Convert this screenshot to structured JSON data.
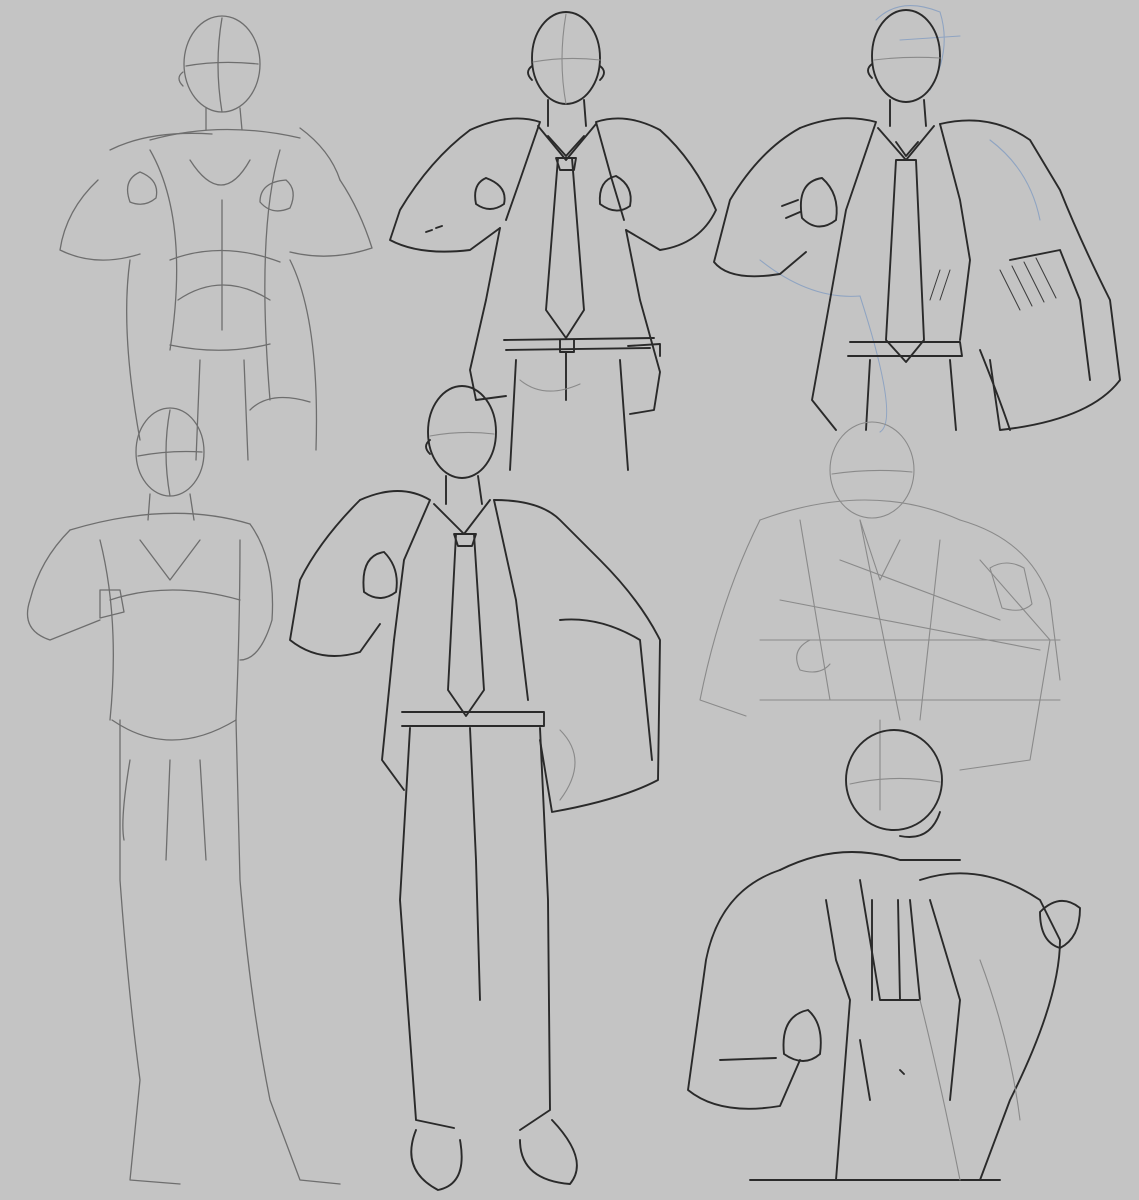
{
  "canvas": {
    "background": "#c4c4c4",
    "ink": "#2a2a2a",
    "construction": "#6e6e6e",
    "guide": "#8fa4c2"
  },
  "sketches": [
    {
      "id": "sketch-1",
      "stage": "rough"
    },
    {
      "id": "sketch-2",
      "stage": "lineart"
    },
    {
      "id": "sketch-3",
      "stage": "lineart"
    },
    {
      "id": "sketch-4",
      "stage": "rough"
    },
    {
      "id": "sketch-5",
      "stage": "lineart"
    },
    {
      "id": "sketch-6",
      "stage": "rough"
    },
    {
      "id": "sketch-7",
      "stage": "lineart"
    }
  ]
}
